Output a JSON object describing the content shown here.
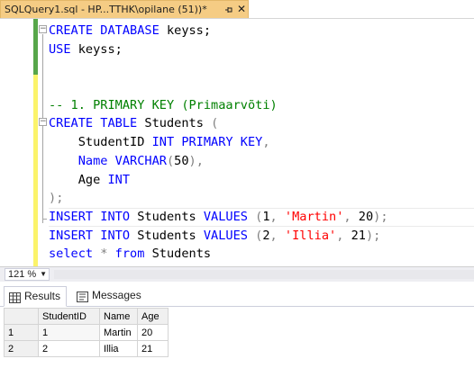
{
  "tab": {
    "title": "SQLQuery1.sql - HP...TTHK\\opilane (51))*",
    "close_glyph": "✕"
  },
  "editor": {
    "lines": [
      [
        {
          "t": "CREATE DATABASE",
          "c": "kw"
        },
        {
          "t": " keyss;",
          "c": ""
        }
      ],
      [
        {
          "t": "USE",
          "c": "kw"
        },
        {
          "t": " keyss;",
          "c": ""
        }
      ],
      [],
      [],
      [
        {
          "t": "-- 1. PRIMARY KEY (Primaarvõti)",
          "c": "cmt"
        }
      ],
      [
        {
          "t": "CREATE TABLE",
          "c": "kw"
        },
        {
          "t": " Students ",
          "c": ""
        },
        {
          "t": "(",
          "c": "gray"
        }
      ],
      [
        {
          "t": "    StudentID ",
          "c": ""
        },
        {
          "t": "INT PRIMARY KEY",
          "c": "kw"
        },
        {
          "t": ",",
          "c": "gray"
        }
      ],
      [
        {
          "t": "    Name ",
          "c": "kw"
        },
        {
          "t": "VARCHAR",
          "c": "kw"
        },
        {
          "t": "(",
          "c": "gray"
        },
        {
          "t": "50",
          "c": ""
        },
        {
          "t": "),",
          "c": "gray"
        }
      ],
      [
        {
          "t": "    Age ",
          "c": ""
        },
        {
          "t": "INT",
          "c": "kw"
        }
      ],
      [
        {
          "t": ")",
          "c": "gray"
        },
        {
          "t": ";",
          "c": "gray"
        }
      ],
      [
        {
          "t": "INSERT INTO",
          "c": "kw"
        },
        {
          "t": " Students ",
          "c": ""
        },
        {
          "t": "VALUES",
          "c": "kw"
        },
        {
          "t": " (",
          "c": "gray"
        },
        {
          "t": "1",
          "c": ""
        },
        {
          "t": ", ",
          "c": "gray"
        },
        {
          "t": "'Martin'",
          "c": "str"
        },
        {
          "t": ", ",
          "c": "gray"
        },
        {
          "t": "20",
          "c": ""
        },
        {
          "t": ");",
          "c": "gray"
        }
      ],
      [
        {
          "t": "INSERT INTO",
          "c": "kw"
        },
        {
          "t": " Students ",
          "c": ""
        },
        {
          "t": "VALUES",
          "c": "kw"
        },
        {
          "t": " (",
          "c": "gray"
        },
        {
          "t": "2",
          "c": ""
        },
        {
          "t": ", ",
          "c": "gray"
        },
        {
          "t": "'Illia'",
          "c": "str"
        },
        {
          "t": ", ",
          "c": "gray"
        },
        {
          "t": "21",
          "c": ""
        },
        {
          "t": ");",
          "c": "gray"
        }
      ],
      [
        {
          "t": "select",
          "c": "kw"
        },
        {
          "t": " ",
          "c": ""
        },
        {
          "t": "*",
          "c": "gray"
        },
        {
          "t": " ",
          "c": ""
        },
        {
          "t": "from",
          "c": "kw"
        },
        {
          "t": " Students",
          "c": ""
        }
      ]
    ],
    "current_line_index": 10
  },
  "zoom": {
    "value": "121 %"
  },
  "results": {
    "tabs": [
      {
        "label": "Results",
        "icon": "grid-icon",
        "active": true
      },
      {
        "label": "Messages",
        "icon": "messages-icon",
        "active": false
      }
    ],
    "columns": [
      "StudentID",
      "Name",
      "Age"
    ],
    "rows": [
      {
        "num": "1",
        "cells": [
          "1",
          "Martin",
          "20"
        ]
      },
      {
        "num": "2",
        "cells": [
          "2",
          "Illia",
          "21"
        ]
      }
    ]
  },
  "colors": {
    "tab_active": "#f5cc84",
    "keyword": "#0000ff",
    "string": "#ff0000",
    "comment": "#008000",
    "change_bar_saved": "#57a64a",
    "change_bar_unsaved": "#fbf36a"
  }
}
